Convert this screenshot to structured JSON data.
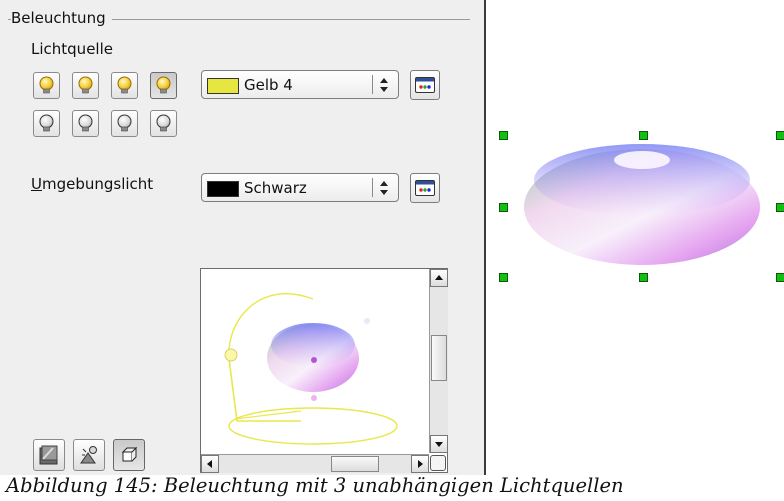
{
  "group_title": "Beleuchtung",
  "light_source": {
    "label": "Lichtquelle",
    "buttons": [
      {
        "state": "on",
        "pressed": false
      },
      {
        "state": "on",
        "pressed": false
      },
      {
        "state": "on",
        "pressed": false
      },
      {
        "state": "on",
        "pressed": true
      },
      {
        "state": "off",
        "pressed": false
      },
      {
        "state": "off",
        "pressed": false
      },
      {
        "state": "off",
        "pressed": false
      },
      {
        "state": "off",
        "pressed": false
      }
    ],
    "color_value": "Gelb 4",
    "color_swatch": "#e6e640"
  },
  "ambient_light": {
    "label_underlined": "U",
    "label_rest": "mgebungslicht",
    "color_value": "Schwarz",
    "color_swatch": "#000000"
  },
  "bottom_toolbar": [
    {
      "icon": "shading-icon"
    },
    {
      "icon": "lighting-icon"
    },
    {
      "icon": "geometry-icon"
    }
  ],
  "caption": "Abbildung 145: Beleuchtung mit 3 unabhängigen Lichtquellen",
  "colors": {
    "handle": "#12c012",
    "panel_bg": "#efefef",
    "light_beam": "#e8e84a"
  }
}
